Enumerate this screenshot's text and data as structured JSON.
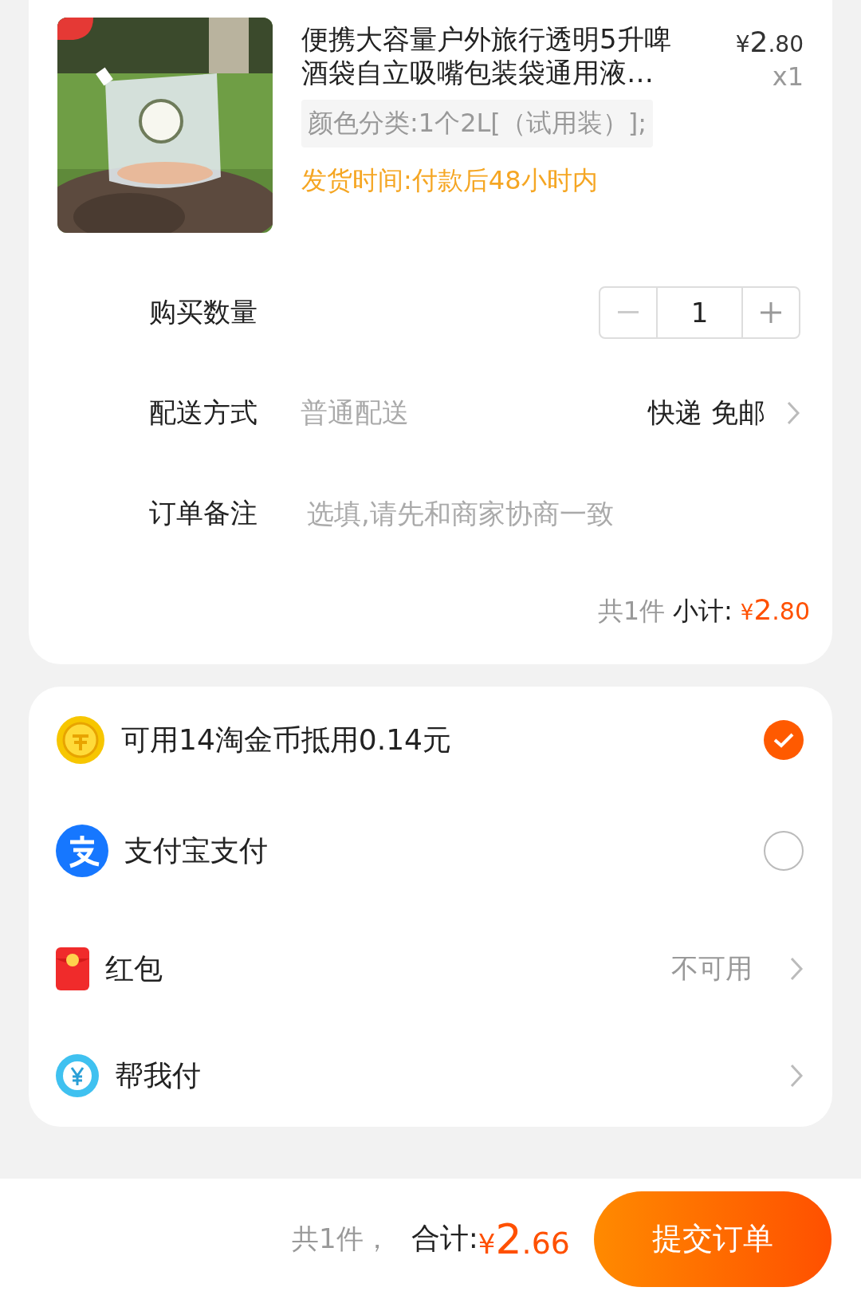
{
  "product": {
    "title": "便携大容量户外旅行透明5升啤酒袋自立吸嘴包装袋通用液…",
    "price": "¥2.80",
    "count": "x1",
    "spec": "颜色分类:1个2L[（试用装）];",
    "shipping": "发货时间:付款后48小时内"
  },
  "quantity": {
    "label": "购买数量",
    "value": "1",
    "minus_disabled": true
  },
  "delivery": {
    "label": "配送方式",
    "value": "普通配送",
    "option": "快递 免邮"
  },
  "note": {
    "label": "订单备注",
    "placeholder": "选填,请先和商家协商一致"
  },
  "subtotal": {
    "count": "共1件",
    "label": "小计:",
    "amount": "¥2.80"
  },
  "payments": [
    {
      "kind": "toggle",
      "label": "可用14淘金币抵用0.14元",
      "checked": true
    },
    {
      "kind": "toggle",
      "label": "支付宝支付",
      "checked": false
    },
    {
      "kind": "link",
      "label": "红包",
      "value": "不可用"
    },
    {
      "kind": "link",
      "label": "帮我付"
    }
  ],
  "footer": {
    "count": "共1件，",
    "total_label": "合计:",
    "total": "¥2.66",
    "submit": "提交订单"
  }
}
